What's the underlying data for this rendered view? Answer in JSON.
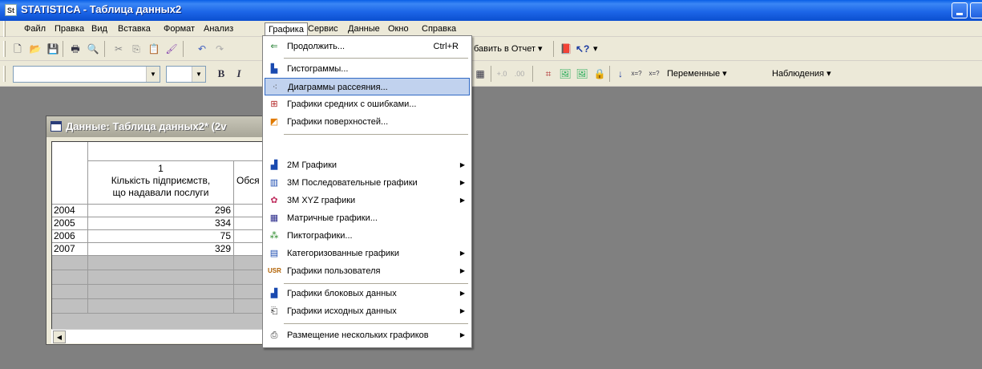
{
  "window": {
    "title": "STATISTICA - Таблица данных2",
    "app_icon": "STATISTICA"
  },
  "menubar": {
    "items": [
      "Файл",
      "Правка",
      "Вид",
      "Вставка",
      "Формат",
      "Анализ",
      "Графика",
      "Сервис",
      "Данные",
      "Окно",
      "Справка"
    ],
    "active": "Графика"
  },
  "toolbar1": {
    "add_report_label": "бавить в Отчет ▾"
  },
  "toolbar2": {
    "font_combo_value": "",
    "size_combo_value": "",
    "bold": "B",
    "italic": "I",
    "variables_label": "Переменные ▾",
    "cases_label": "Наблюдения ▾"
  },
  "data_window": {
    "title": "Данные: Таблица данных2* (2v",
    "col1_number": "1",
    "col1_name_line1": "Кількість підприємств,",
    "col1_name_line2": "що надавали послуги",
    "col2_fragment": "Обся",
    "rows": [
      {
        "label": "2004",
        "value": "296"
      },
      {
        "label": "2005",
        "value": "334"
      },
      {
        "label": "2006",
        "value": "75"
      },
      {
        "label": "2007",
        "value": "329"
      }
    ]
  },
  "graphics_menu": {
    "items": [
      {
        "label": "Продолжить...",
        "shortcut": "Ctrl+R",
        "icon": "continue-icon"
      },
      {
        "label": "Гистограммы...",
        "icon": "histogram-icon"
      },
      {
        "label": "Диаграммы рассеяния...",
        "icon": "scatterplot-icon",
        "highlighted": true
      },
      {
        "label": "Графики средних с ошибками...",
        "icon": "means-error-icon"
      },
      {
        "label": "Графики поверхностей...",
        "icon": "surface-icon"
      },
      {
        "label": "2М Графики",
        "icon": "2d-graphs-icon",
        "submenu": true
      },
      {
        "label": "3М Последовательные графики",
        "icon": "3d-sequential-icon",
        "submenu": true
      },
      {
        "label": "3М XYZ графики",
        "icon": "3d-xyz-icon",
        "submenu": true
      },
      {
        "label": "Матричные графики...",
        "icon": "matrix-icon"
      },
      {
        "label": "Пиктографики...",
        "icon": "icon-plots-icon"
      },
      {
        "label": "Категоризованные графики",
        "icon": "categorized-icon",
        "submenu": true
      },
      {
        "label": "Графики пользователя",
        "icon": "user-graphs-icon",
        "submenu": true
      },
      {
        "label": "Графики блоковых данных",
        "icon": "block-data-icon",
        "submenu": true
      },
      {
        "label": "Графики исходных данных",
        "icon": "input-data-icon",
        "submenu": true
      },
      {
        "label": "Размещение нескольких графиков",
        "icon": "multiple-graphs-icon",
        "submenu": true
      }
    ]
  }
}
